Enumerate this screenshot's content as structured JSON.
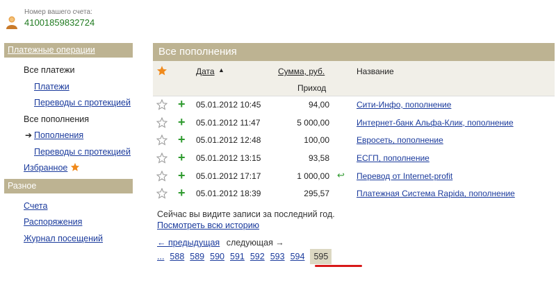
{
  "account": {
    "label": "Номер вашего счета:",
    "number": "41001859832724"
  },
  "sidebar": {
    "section1": "Платежные операции",
    "items1": [
      {
        "label": "Все платежи"
      },
      {
        "label": "Платежи"
      },
      {
        "label": "Переводы с протекцией"
      },
      {
        "label": "Все пополнения"
      },
      {
        "label": "Пополнения"
      },
      {
        "label": "Переводы с протекцией"
      },
      {
        "label": "Избранное"
      }
    ],
    "section2": "Разное",
    "items2": [
      {
        "label": "Счета"
      },
      {
        "label": "Распоряжения"
      },
      {
        "label": "Журнал посещений"
      }
    ]
  },
  "main": {
    "title": "Все пополнения",
    "columns": {
      "date": "Дата",
      "amount": "Сумма, руб.",
      "amount_sub": "Приход",
      "name": "Название"
    },
    "rows": [
      {
        "date": "05.01.2012 10:45",
        "amount": "94,00",
        "name": "Сити-Инфо, пополнение",
        "return": false
      },
      {
        "date": "05.01.2012 11:47",
        "amount": "5 000,00",
        "name": "Интернет-банк Альфа-Клик, пополнение",
        "return": false
      },
      {
        "date": "05.01.2012 12:48",
        "amount": "100,00",
        "name": "Евросеть, пополнение",
        "return": false
      },
      {
        "date": "05.01.2012 13:15",
        "amount": "93,58",
        "name": "ЕСГП, пополнение",
        "return": false
      },
      {
        "date": "05.01.2012 17:17",
        "amount": "1 000,00",
        "name": "Перевод от Internet-profit",
        "return": true
      },
      {
        "date": "05.01.2012 18:39",
        "amount": "295,57",
        "name": "Платежная Система Rapida, пополнение",
        "return": false
      }
    ],
    "note": "Сейчас вы видите записи за последний год.",
    "history_link": "Посмотреть всю историю",
    "prev": "← предыдущая",
    "next": "следующая →",
    "pages": [
      "...",
      "588",
      "589",
      "590",
      "591",
      "592",
      "593",
      "594"
    ],
    "current_page": "595"
  },
  "colors": {
    "header_bg": "#bdb392",
    "link": "#1a3a9c",
    "plus": "#2e9a2e",
    "star": "#f08a1c"
  }
}
